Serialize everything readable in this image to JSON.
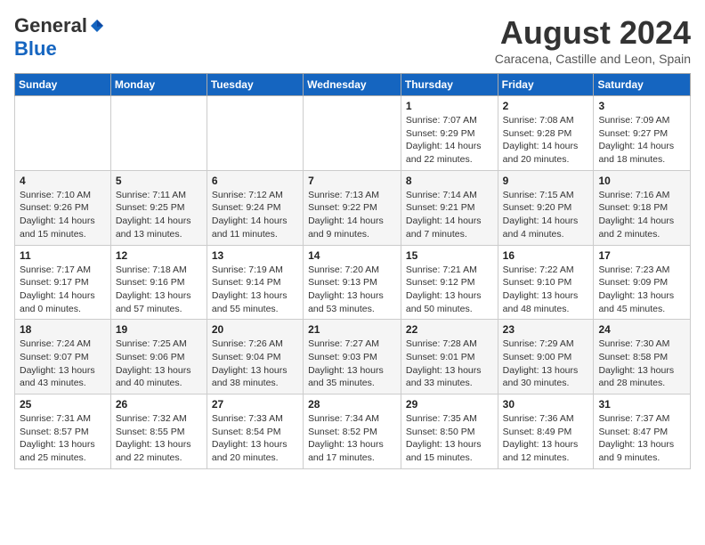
{
  "header": {
    "logo_general": "General",
    "logo_blue": "Blue",
    "month_year": "August 2024",
    "location": "Caracena, Castille and Leon, Spain"
  },
  "days_of_week": [
    "Sunday",
    "Monday",
    "Tuesday",
    "Wednesday",
    "Thursday",
    "Friday",
    "Saturday"
  ],
  "weeks": [
    [
      {
        "day": "",
        "info": ""
      },
      {
        "day": "",
        "info": ""
      },
      {
        "day": "",
        "info": ""
      },
      {
        "day": "",
        "info": ""
      },
      {
        "day": "1",
        "info": "Sunrise: 7:07 AM\nSunset: 9:29 PM\nDaylight: 14 hours\nand 22 minutes."
      },
      {
        "day": "2",
        "info": "Sunrise: 7:08 AM\nSunset: 9:28 PM\nDaylight: 14 hours\nand 20 minutes."
      },
      {
        "day": "3",
        "info": "Sunrise: 7:09 AM\nSunset: 9:27 PM\nDaylight: 14 hours\nand 18 minutes."
      }
    ],
    [
      {
        "day": "4",
        "info": "Sunrise: 7:10 AM\nSunset: 9:26 PM\nDaylight: 14 hours\nand 15 minutes."
      },
      {
        "day": "5",
        "info": "Sunrise: 7:11 AM\nSunset: 9:25 PM\nDaylight: 14 hours\nand 13 minutes."
      },
      {
        "day": "6",
        "info": "Sunrise: 7:12 AM\nSunset: 9:24 PM\nDaylight: 14 hours\nand 11 minutes."
      },
      {
        "day": "7",
        "info": "Sunrise: 7:13 AM\nSunset: 9:22 PM\nDaylight: 14 hours\nand 9 minutes."
      },
      {
        "day": "8",
        "info": "Sunrise: 7:14 AM\nSunset: 9:21 PM\nDaylight: 14 hours\nand 7 minutes."
      },
      {
        "day": "9",
        "info": "Sunrise: 7:15 AM\nSunset: 9:20 PM\nDaylight: 14 hours\nand 4 minutes."
      },
      {
        "day": "10",
        "info": "Sunrise: 7:16 AM\nSunset: 9:18 PM\nDaylight: 14 hours\nand 2 minutes."
      }
    ],
    [
      {
        "day": "11",
        "info": "Sunrise: 7:17 AM\nSunset: 9:17 PM\nDaylight: 14 hours\nand 0 minutes."
      },
      {
        "day": "12",
        "info": "Sunrise: 7:18 AM\nSunset: 9:16 PM\nDaylight: 13 hours\nand 57 minutes."
      },
      {
        "day": "13",
        "info": "Sunrise: 7:19 AM\nSunset: 9:14 PM\nDaylight: 13 hours\nand 55 minutes."
      },
      {
        "day": "14",
        "info": "Sunrise: 7:20 AM\nSunset: 9:13 PM\nDaylight: 13 hours\nand 53 minutes."
      },
      {
        "day": "15",
        "info": "Sunrise: 7:21 AM\nSunset: 9:12 PM\nDaylight: 13 hours\nand 50 minutes."
      },
      {
        "day": "16",
        "info": "Sunrise: 7:22 AM\nSunset: 9:10 PM\nDaylight: 13 hours\nand 48 minutes."
      },
      {
        "day": "17",
        "info": "Sunrise: 7:23 AM\nSunset: 9:09 PM\nDaylight: 13 hours\nand 45 minutes."
      }
    ],
    [
      {
        "day": "18",
        "info": "Sunrise: 7:24 AM\nSunset: 9:07 PM\nDaylight: 13 hours\nand 43 minutes."
      },
      {
        "day": "19",
        "info": "Sunrise: 7:25 AM\nSunset: 9:06 PM\nDaylight: 13 hours\nand 40 minutes."
      },
      {
        "day": "20",
        "info": "Sunrise: 7:26 AM\nSunset: 9:04 PM\nDaylight: 13 hours\nand 38 minutes."
      },
      {
        "day": "21",
        "info": "Sunrise: 7:27 AM\nSunset: 9:03 PM\nDaylight: 13 hours\nand 35 minutes."
      },
      {
        "day": "22",
        "info": "Sunrise: 7:28 AM\nSunset: 9:01 PM\nDaylight: 13 hours\nand 33 minutes."
      },
      {
        "day": "23",
        "info": "Sunrise: 7:29 AM\nSunset: 9:00 PM\nDaylight: 13 hours\nand 30 minutes."
      },
      {
        "day": "24",
        "info": "Sunrise: 7:30 AM\nSunset: 8:58 PM\nDaylight: 13 hours\nand 28 minutes."
      }
    ],
    [
      {
        "day": "25",
        "info": "Sunrise: 7:31 AM\nSunset: 8:57 PM\nDaylight: 13 hours\nand 25 minutes."
      },
      {
        "day": "26",
        "info": "Sunrise: 7:32 AM\nSunset: 8:55 PM\nDaylight: 13 hours\nand 22 minutes."
      },
      {
        "day": "27",
        "info": "Sunrise: 7:33 AM\nSunset: 8:54 PM\nDaylight: 13 hours\nand 20 minutes."
      },
      {
        "day": "28",
        "info": "Sunrise: 7:34 AM\nSunset: 8:52 PM\nDaylight: 13 hours\nand 17 minutes."
      },
      {
        "day": "29",
        "info": "Sunrise: 7:35 AM\nSunset: 8:50 PM\nDaylight: 13 hours\nand 15 minutes."
      },
      {
        "day": "30",
        "info": "Sunrise: 7:36 AM\nSunset: 8:49 PM\nDaylight: 13 hours\nand 12 minutes."
      },
      {
        "day": "31",
        "info": "Sunrise: 7:37 AM\nSunset: 8:47 PM\nDaylight: 13 hours\nand 9 minutes."
      }
    ]
  ]
}
